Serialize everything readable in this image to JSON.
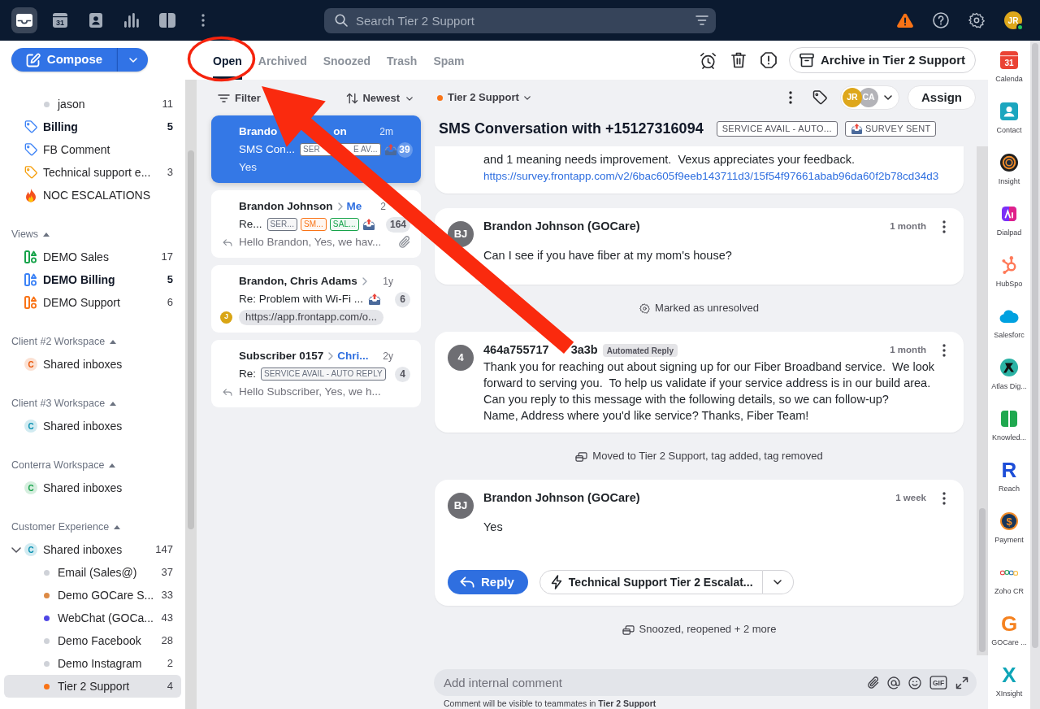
{
  "top_bar": {
    "nav": [
      {
        "kind": "inbox",
        "selected": true
      },
      {
        "kind": "calendar",
        "text": "31",
        "selected": false
      },
      {
        "kind": "contacts",
        "selected": false
      },
      {
        "kind": "analytics",
        "selected": false
      },
      {
        "kind": "book",
        "selected": false
      },
      {
        "kind": "more",
        "selected": false
      }
    ],
    "search": {
      "placeholder": "Search Tier 2 Support"
    },
    "actions": [
      {
        "kind": "warning"
      },
      {
        "kind": "help"
      },
      {
        "kind": "settings"
      }
    ],
    "user": {
      "initials": "JR",
      "online": true
    }
  },
  "sidebar": {
    "compose": "Compose",
    "items": [
      {
        "kind": "dot",
        "label": "jason",
        "count": "11",
        "color": "#cfd2d8",
        "unread": false,
        "selected": false
      },
      {
        "kind": "tag",
        "label": "Billing",
        "count": "5",
        "color": "#3b82f6",
        "unread": true,
        "selected": false
      },
      {
        "kind": "tag",
        "label": "FB Comment",
        "color": "#3b82f6",
        "unread": false,
        "selected": false
      },
      {
        "kind": "tag",
        "label": "Technical support e...",
        "count": "3",
        "color": "#f59e0b",
        "unread": false,
        "selected": false
      },
      {
        "kind": "flame",
        "label": "NOC ESCALATIONS",
        "unread": false,
        "selected": false
      }
    ],
    "sections": [
      {
        "title": "Views",
        "expanded": true,
        "items": [
          {
            "kind": "view",
            "label": "DEMO Sales",
            "count": "17",
            "color": "#16a34a",
            "unread": false,
            "selected": false
          },
          {
            "kind": "view",
            "label": "DEMO Billing",
            "count": "5",
            "color": "#3b82f6",
            "unread": true,
            "selected": false
          },
          {
            "kind": "view",
            "label": "DEMO Support",
            "count": "6",
            "color": "#f97316",
            "unread": false,
            "selected": false
          }
        ]
      },
      {
        "title": "Client #2 Workspace",
        "expanded": true,
        "items": [
          {
            "kind": "workspace",
            "initial": "C",
            "label": "Shared inboxes",
            "color": "#ea580c",
            "selected": false
          }
        ]
      },
      {
        "title": "Client #3 Workspace",
        "expanded": true,
        "items": [
          {
            "kind": "workspace",
            "initial": "C",
            "label": "Shared inboxes",
            "color": "#0891b2",
            "selected": false
          }
        ]
      },
      {
        "title": "Conterra Workspace",
        "expanded": true,
        "items": [
          {
            "kind": "workspace",
            "initial": "C",
            "label": "Shared inboxes",
            "color": "#16a34a",
            "selected": false
          }
        ]
      },
      {
        "title": "Customer Experience",
        "expanded": true,
        "items": [
          {
            "kind": "workspace",
            "initial": "C",
            "label": "Shared inboxes",
            "count": "147",
            "color": "#0891b2",
            "expanded": true,
            "selected": false,
            "children": [
              {
                "kind": "dot",
                "label": "Email (Sales@)",
                "count": "37",
                "color": "#cfd2d8",
                "unread": false,
                "selected": false
              },
              {
                "kind": "dot",
                "label": "Demo GOCare S...",
                "count": "33",
                "color": "#dd8a45",
                "unread": false,
                "selected": false
              },
              {
                "kind": "dot",
                "label": "WebChat (GOCa...",
                "count": "43",
                "color": "#4f46e5",
                "unread": false,
                "selected": false
              },
              {
                "kind": "dot",
                "label": "Demo Facebook",
                "count": "28",
                "color": "#cfd2d8",
                "unread": false,
                "selected": false
              },
              {
                "kind": "dot",
                "label": "Demo Instagram",
                "count": "2",
                "color": "#cfd2d8",
                "unread": false,
                "selected": false
              },
              {
                "kind": "dot",
                "label": "Tier 2 Support",
                "count": "4",
                "color": "#f97316",
                "unread": false,
                "selected": true
              }
            ]
          }
        ]
      }
    ]
  },
  "tabs": [
    {
      "label": "Open",
      "selected": true
    },
    {
      "label": "Archived",
      "selected": false
    },
    {
      "label": "Snoozed",
      "selected": false
    },
    {
      "label": "Trash",
      "selected": false
    },
    {
      "label": "Spam",
      "selected": false
    }
  ],
  "toolbar": {
    "actions": [
      {
        "kind": "snooze"
      },
      {
        "kind": "delete"
      },
      {
        "kind": "spam"
      }
    ],
    "archive_button": "Archive in Tier 2 Support"
  },
  "conversation_list": {
    "filter": "Filter",
    "sort": "Newest",
    "cards": [
      {
        "selected": true,
        "sender": [
          "Brando",
          "on"
        ],
        "time": "2m",
        "subject": "SMS Con...",
        "tags": [
          {
            "label": [
              "SER",
              "E AV..."
            ],
            "color": "#6b7280"
          }
        ],
        "survey": true,
        "count": "39",
        "preview": {
          "kind": "text",
          "text": "Yes"
        },
        "attachment": false
      },
      {
        "selected": false,
        "sender": "Brandon Johnson",
        "to": "Me",
        "time": "2",
        "subject": "Re...",
        "tags": [
          {
            "label": "SER...",
            "color": "#6b7280"
          },
          {
            "label": "SM...",
            "color": "#f97316"
          },
          {
            "label": "SAL...",
            "color": "#16a34a"
          }
        ],
        "survey": true,
        "count": "164",
        "preview": {
          "kind": "reply",
          "text": "Hello Brandon, Yes, we hav..."
        },
        "attachment": true
      },
      {
        "selected": false,
        "sender": "Brandon, Chris Adams",
        "recipient_cut": true,
        "time": "1y",
        "subject": "Re: Problem with Wi-Fi ...",
        "survey": true,
        "count": "6",
        "preview": {
          "kind": "link",
          "avatar": "J",
          "text": "https://app.frontapp.com/o..."
        },
        "attachment": false
      },
      {
        "selected": false,
        "sender": "Subscriber 0157",
        "to": "Chri...",
        "time": "2y",
        "subject": "Re:",
        "tags": [
          {
            "label": "SERVICE AVAIL - AUTO REPLY",
            "color": "#6b7280"
          }
        ],
        "survey": false,
        "count": "4",
        "preview": {
          "kind": "reply",
          "text": "Hello Subscriber, Yes, we h..."
        },
        "attachment": false
      }
    ]
  },
  "conversation": {
    "inbox": {
      "label": "Tier 2 Support",
      "color": "#f97316"
    },
    "header_actions": [
      {
        "kind": "more"
      },
      {
        "kind": "tag"
      }
    ],
    "assignees": [
      {
        "initials": "JR",
        "color": "#dea71b"
      },
      {
        "initials": "CA",
        "color": "#b3b3b8"
      }
    ],
    "assign_button": "Assign",
    "title": "SMS Conversation with +15127316094",
    "tags": [
      {
        "kind": "plain",
        "label": "SERVICE AVAIL - AUTO..."
      },
      {
        "kind": "survey",
        "label": "SURVEY SENT"
      }
    ],
    "timeline": [
      {
        "kind": "message_tail",
        "text": "and 1 meaning needs improvement.  Vexus appreciates your feedback.",
        "link": "https://survey.frontapp.com/v2/6bac605f9eeb143711d3/15f54f97661abab96da60f2b78cd34d3"
      },
      {
        "kind": "message",
        "avatar": "BJ",
        "author": "Brandon Johnson (GOCare)",
        "time": "1 month",
        "body": "Can I see if you have fiber at my mom's house?"
      },
      {
        "kind": "status",
        "text": "Marked as unresolved"
      },
      {
        "kind": "automated",
        "avatar": "4",
        "author": [
          "464a755717",
          "3a3b"
        ],
        "badge": "Automated Reply",
        "time": "1 month",
        "body": "Thank you for reaching out about signing up for our Fiber Broadband service.  We look forward to serving you.  To help us validate if your service address is in our build area.\nCan you reply to this message with the following details, so we can follow-up?\nName, Address where you'd like service? Thanks, Fiber Team!"
      },
      {
        "kind": "activity",
        "text": "Moved to Tier 2 Support, tag added, tag removed"
      },
      {
        "kind": "message",
        "avatar": "BJ",
        "author": "Brandon Johnson (GOCare)",
        "time": "1 week",
        "body": "Yes",
        "reply_button": "Reply",
        "macro_button": "Technical Support Tier 2 Escalat..."
      },
      {
        "kind": "activity",
        "text": "Snoozed, reopened + 2 more"
      }
    ],
    "composer": {
      "placeholder": "Add internal comment",
      "tools": [
        {
          "kind": "attach"
        },
        {
          "kind": "mention"
        },
        {
          "kind": "emoji"
        },
        {
          "kind": "gif",
          "text": "GIF"
        },
        {
          "kind": "expand"
        }
      ],
      "note": "Comment will be visible to teammates in **Tier 2 Support**"
    }
  },
  "app_bar": [
    {
      "kind": "calendar",
      "text": "31",
      "label": "Calenda"
    },
    {
      "kind": "contact",
      "label": "Contact"
    },
    {
      "kind": "target",
      "label": "Insight"
    },
    {
      "kind": "tile",
      "label": "Dialpad"
    },
    {
      "kind": "sprocket",
      "label": "HubSpo"
    },
    {
      "kind": "cloud",
      "label": "Salesforc"
    },
    {
      "kind": "figure",
      "label": "Atlas Dig..."
    },
    {
      "kind": "book",
      "label": "Knowled..."
    },
    {
      "kind": "letter",
      "text": "R",
      "color": "#1d4ed8",
      "label": "Reach"
    },
    {
      "kind": "coin",
      "text": "$",
      "label": "Payment"
    },
    {
      "kind": "rings",
      "label": "Zoho CR"
    },
    {
      "kind": "letter",
      "text": "G",
      "color": "#f58220",
      "label": "GOCare ..."
    },
    {
      "kind": "letter",
      "text": "X",
      "color": "#0ea5b7",
      "label": "XInsight"
    }
  ],
  "annotations": [
    {
      "kind": "ellipse"
    },
    {
      "kind": "arrow"
    }
  ]
}
